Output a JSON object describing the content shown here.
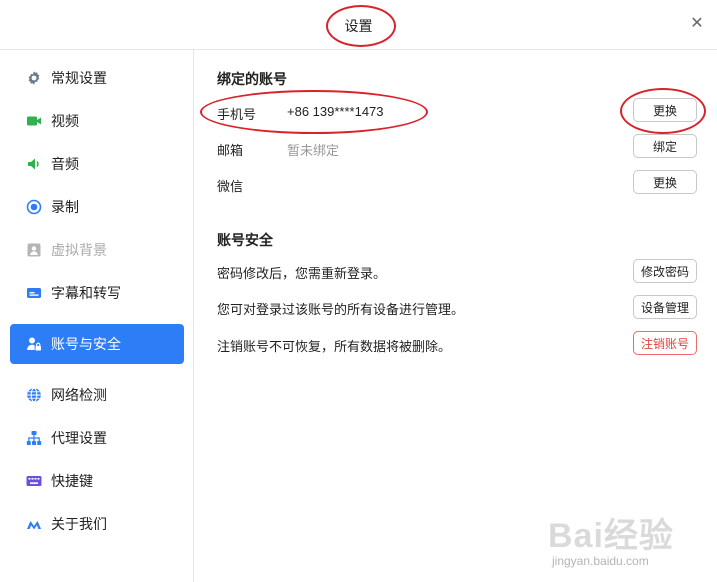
{
  "window": {
    "title": "设置"
  },
  "sidebar": {
    "items": [
      {
        "label": "常规设置",
        "icon": "gear-icon"
      },
      {
        "label": "视频",
        "icon": "video-camera-icon"
      },
      {
        "label": "音频",
        "icon": "speaker-icon"
      },
      {
        "label": "录制",
        "icon": "record-icon"
      },
      {
        "label": "虚拟背景",
        "icon": "portrait-icon",
        "disabled": true
      },
      {
        "label": "字幕和转写",
        "icon": "subtitles-icon"
      },
      {
        "label": "账号与安全",
        "icon": "user-lock-icon",
        "active": true
      },
      {
        "label": "网络检测",
        "icon": "globe-icon"
      },
      {
        "label": "代理设置",
        "icon": "network-tree-icon"
      },
      {
        "label": "快捷键",
        "icon": "keyboard-icon"
      },
      {
        "label": "关于我们",
        "icon": "logo-icon"
      }
    ]
  },
  "bound_accounts": {
    "title": "绑定的账号",
    "rows": [
      {
        "label": "手机号",
        "value": "+86 139****1473",
        "button": "更换"
      },
      {
        "label": "邮箱",
        "value": "暂未绑定",
        "button": "绑定"
      },
      {
        "label": "微信",
        "value": "",
        "button": "更换"
      }
    ]
  },
  "account_security": {
    "title": "账号安全",
    "rows": [
      {
        "text": "密码修改后，您需重新登录。",
        "button": "修改密码"
      },
      {
        "text": "您可对登录过该账号的所有设备进行管理。",
        "button": "设备管理"
      },
      {
        "text": "注销账号不可恢复，所有数据将被删除。",
        "button": "注销账号"
      }
    ]
  },
  "colors": {
    "accent": "#2c7df6",
    "danger": "#e0443e",
    "annotation": "#d9232a",
    "icon_gear": "#6b7a8f",
    "icon_video": "#2fb24c",
    "icon_audio": "#2fb24c",
    "icon_record": "#2c7df6",
    "icon_disabled": "#b5b5b5",
    "icon_blue": "#2c7df6",
    "icon_purple": "#6a4fd8"
  },
  "watermark": {
    "main": "Bai经验",
    "sub": "jingyan.baidu.com"
  }
}
